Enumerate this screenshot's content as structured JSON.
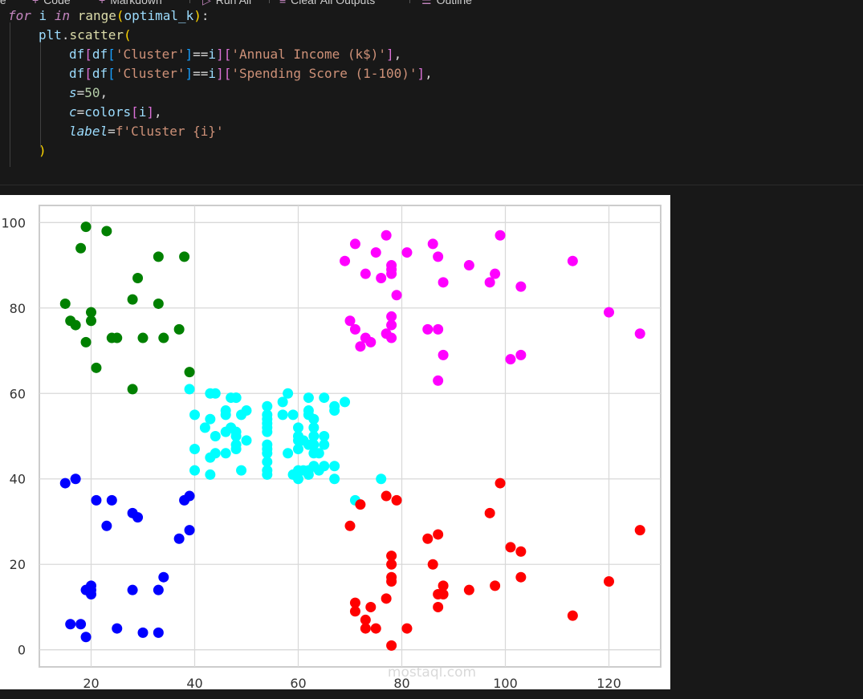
{
  "toolbar": {
    "items": [
      {
        "label": "te",
        "icon": ""
      },
      {
        "label": "Code",
        "icon": "plus-icon"
      },
      {
        "label": "Markdown",
        "icon": "plus-icon"
      },
      {
        "label": "Run All",
        "icon": "run-all-icon"
      },
      {
        "label": "Clear All Outputs",
        "icon": "clear-outputs-icon"
      },
      {
        "label": "Outline",
        "icon": "outline-icon"
      }
    ]
  },
  "code": {
    "for_kw": "for",
    "for_var": "i",
    "in_kw": "in",
    "range_fn": "range",
    "range_arg": "optimal_k",
    "plt": "plt",
    "scatter": "scatter",
    "df": "df",
    "cluster_key": "'Cluster'",
    "eq": "==",
    "i": "i",
    "income_key": "'Annual Income (k$)'",
    "spending_key": "'Spending Score (1-100)'",
    "s_kw": "s",
    "s_val": "50",
    "c_kw": "c",
    "colors": "colors",
    "label_kw": "label",
    "fstring": "f'Cluster {i}'"
  },
  "chart_data": {
    "type": "scatter",
    "xlim": [
      10,
      130
    ],
    "ylim": [
      -4,
      104
    ],
    "x_ticks": [
      20,
      40,
      60,
      80,
      100,
      120
    ],
    "y_ticks": [
      0,
      20,
      40,
      60,
      80,
      100
    ],
    "grid": true,
    "series": [
      {
        "color": "#0000ff",
        "points": [
          [
            15,
            39
          ],
          [
            16,
            6
          ],
          [
            17,
            40
          ],
          [
            18,
            6
          ],
          [
            19,
            3
          ],
          [
            19,
            14
          ],
          [
            20,
            15
          ],
          [
            20,
            13
          ],
          [
            21,
            35
          ],
          [
            23,
            29
          ],
          [
            24,
            35
          ],
          [
            25,
            5
          ],
          [
            28,
            14
          ],
          [
            28,
            32
          ],
          [
            29,
            31
          ],
          [
            30,
            4
          ],
          [
            33,
            4
          ],
          [
            33,
            14
          ],
          [
            34,
            17
          ],
          [
            37,
            26
          ],
          [
            38,
            35
          ],
          [
            39,
            36
          ],
          [
            39,
            28
          ],
          [
            20,
            14
          ]
        ]
      },
      {
        "color": "#008000",
        "points": [
          [
            15,
            81
          ],
          [
            16,
            77
          ],
          [
            17,
            76
          ],
          [
            18,
            94
          ],
          [
            19,
            99
          ],
          [
            19,
            72
          ],
          [
            20,
            79
          ],
          [
            20,
            77
          ],
          [
            21,
            66
          ],
          [
            23,
            98
          ],
          [
            24,
            73
          ],
          [
            25,
            73
          ],
          [
            28,
            82
          ],
          [
            28,
            61
          ],
          [
            29,
            87
          ],
          [
            30,
            73
          ],
          [
            33,
            92
          ],
          [
            33,
            81
          ],
          [
            34,
            73
          ],
          [
            37,
            75
          ],
          [
            38,
            92
          ],
          [
            39,
            65
          ]
        ]
      },
      {
        "color": "#00ffff",
        "points": [
          [
            39,
            61
          ],
          [
            40,
            55
          ],
          [
            40,
            47
          ],
          [
            40,
            42
          ],
          [
            42,
            52
          ],
          [
            43,
            60
          ],
          [
            43,
            54
          ],
          [
            43,
            45
          ],
          [
            43,
            41
          ],
          [
            44,
            60
          ],
          [
            44,
            50
          ],
          [
            44,
            46
          ],
          [
            46,
            51
          ],
          [
            46,
            46
          ],
          [
            46,
            56
          ],
          [
            46,
            55
          ],
          [
            47,
            52
          ],
          [
            47,
            59
          ],
          [
            48,
            51
          ],
          [
            48,
            59
          ],
          [
            48,
            50
          ],
          [
            48,
            48
          ],
          [
            48,
            59
          ],
          [
            48,
            47
          ],
          [
            49,
            55
          ],
          [
            49,
            42
          ],
          [
            50,
            49
          ],
          [
            50,
            56
          ],
          [
            54,
            47
          ],
          [
            54,
            54
          ],
          [
            54,
            53
          ],
          [
            54,
            48
          ],
          [
            54,
            52
          ],
          [
            54,
            42
          ],
          [
            54,
            51
          ],
          [
            54,
            55
          ],
          [
            54,
            41
          ],
          [
            54,
            44
          ],
          [
            54,
            57
          ],
          [
            54,
            46
          ],
          [
            57,
            58
          ],
          [
            57,
            55
          ],
          [
            58,
            60
          ],
          [
            58,
            46
          ],
          [
            59,
            55
          ],
          [
            59,
            41
          ],
          [
            60,
            49
          ],
          [
            60,
            40
          ],
          [
            60,
            42
          ],
          [
            60,
            52
          ],
          [
            60,
            47
          ],
          [
            60,
            50
          ],
          [
            61,
            42
          ],
          [
            61,
            49
          ],
          [
            62,
            41
          ],
          [
            62,
            48
          ],
          [
            62,
            59
          ],
          [
            62,
            55
          ],
          [
            62,
            56
          ],
          [
            62,
            42
          ],
          [
            63,
            50
          ],
          [
            63,
            46
          ],
          [
            63,
            43
          ],
          [
            63,
            48
          ],
          [
            63,
            52
          ],
          [
            63,
            54
          ],
          [
            64,
            42
          ],
          [
            64,
            46
          ],
          [
            65,
            48
          ],
          [
            65,
            50
          ],
          [
            65,
            43
          ],
          [
            65,
            59
          ],
          [
            67,
            43
          ],
          [
            67,
            57
          ],
          [
            67,
            56
          ],
          [
            67,
            40
          ],
          [
            69,
            58
          ],
          [
            71,
            35
          ],
          [
            76,
            40
          ]
        ]
      },
      {
        "color": "#ff0000",
        "points": [
          [
            70,
            29
          ],
          [
            71,
            11
          ],
          [
            71,
            9
          ],
          [
            72,
            34
          ],
          [
            73,
            5
          ],
          [
            73,
            7
          ],
          [
            74,
            10
          ],
          [
            75,
            5
          ],
          [
            77,
            12
          ],
          [
            77,
            36
          ],
          [
            78,
            22
          ],
          [
            78,
            17
          ],
          [
            78,
            20
          ],
          [
            78,
            16
          ],
          [
            78,
            1
          ],
          [
            79,
            35
          ],
          [
            81,
            5
          ],
          [
            85,
            26
          ],
          [
            86,
            20
          ],
          [
            87,
            27
          ],
          [
            87,
            13
          ],
          [
            87,
            10
          ],
          [
            88,
            13
          ],
          [
            88,
            15
          ],
          [
            93,
            14
          ],
          [
            97,
            32
          ],
          [
            98,
            15
          ],
          [
            99,
            39
          ],
          [
            101,
            24
          ],
          [
            103,
            17
          ],
          [
            103,
            23
          ],
          [
            113,
            8
          ],
          [
            120,
            16
          ],
          [
            126,
            28
          ]
        ]
      },
      {
        "color": "#ff00ff",
        "points": [
          [
            69,
            91
          ],
          [
            70,
            77
          ],
          [
            71,
            95
          ],
          [
            71,
            75
          ],
          [
            72,
            71
          ],
          [
            73,
            88
          ],
          [
            73,
            73
          ],
          [
            74,
            72
          ],
          [
            75,
            93
          ],
          [
            76,
            87
          ],
          [
            77,
            97
          ],
          [
            77,
            74
          ],
          [
            78,
            90
          ],
          [
            78,
            88
          ],
          [
            78,
            76
          ],
          [
            78,
            89
          ],
          [
            78,
            78
          ],
          [
            78,
            73
          ],
          [
            79,
            83
          ],
          [
            81,
            93
          ],
          [
            85,
            75
          ],
          [
            86,
            95
          ],
          [
            87,
            63
          ],
          [
            87,
            75
          ],
          [
            87,
            92
          ],
          [
            88,
            86
          ],
          [
            88,
            69
          ],
          [
            93,
            90
          ],
          [
            97,
            86
          ],
          [
            98,
            88
          ],
          [
            99,
            97
          ],
          [
            101,
            68
          ],
          [
            103,
            85
          ],
          [
            103,
            69
          ],
          [
            113,
            91
          ],
          [
            120,
            79
          ],
          [
            126,
            74
          ]
        ]
      }
    ]
  },
  "watermark": {
    "text": "mostaql.com"
  }
}
